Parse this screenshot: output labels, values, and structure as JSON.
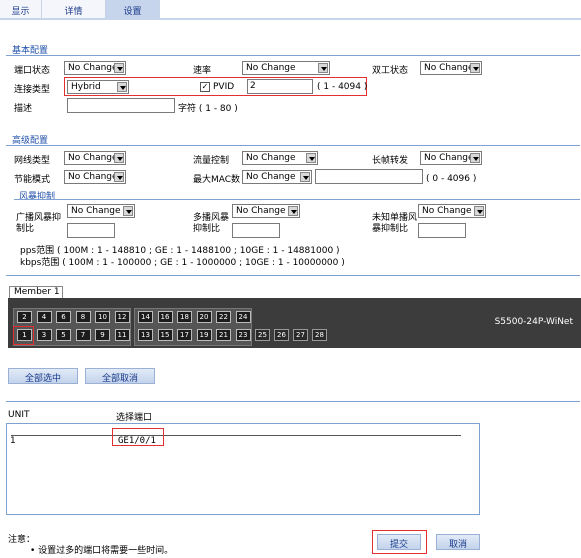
{
  "tabs": [
    "显示",
    "详情",
    "设置"
  ],
  "basic": {
    "title": "基本配置",
    "port_state_label": "端口状态",
    "port_state_value": "No Change",
    "speed_label": "速率",
    "speed_value": "No Change",
    "duplex_label": "双工状态",
    "duplex_value": "No Change",
    "link_type_label": "连接类型",
    "link_type_value": "Hybrid",
    "pvid_label": "PVID",
    "pvid_value": "2",
    "pvid_range": "( 1 - 4094 )",
    "desc_label": "描述",
    "desc_value": "",
    "desc_hint": "字符 ( 1 - 80 )"
  },
  "advanced": {
    "title": "高级配置",
    "mdi_label": "网线类型",
    "mdi_value": "No Change",
    "flow_label": "流量控制",
    "flow_value": "No Change",
    "jumbo_label": "长帧转发",
    "jumbo_value": "No Change",
    "power_label": "节能模式",
    "power_value": "No Change",
    "mac_label": "最大MAC数",
    "mac_value": "No Change",
    "mac_input": "",
    "mac_range": "( 0 - 4096 )"
  },
  "storm": {
    "title": "风暴抑制",
    "broadcast_label_1": "广播风暴抑",
    "broadcast_label_2": "制比",
    "broadcast_value": "No Change",
    "broadcast_input": "",
    "multicast_label_1": "多播风暴",
    "multicast_label_2": "抑制比",
    "multicast_value": "No Change",
    "multicast_input": "",
    "unicast_label_1": "未知单播风",
    "unicast_label_2": "暴抑制比",
    "unicast_value": "No Change",
    "unicast_input": "",
    "pps_range": "pps范围 ( 100M : 1 - 148810 ; GE : 1 - 1488100 ; 10GE : 1 - 14881000 )",
    "kbps_range": "kbps范围 ( 100M : 1 - 100000 ; GE : 1 - 1000000 ; 10GE : 1 - 10000000 )"
  },
  "device": {
    "member_tab": "Member 1",
    "model": "S5500-24P-WiNet",
    "top_ports": [
      "2",
      "4",
      "6",
      "8",
      "10",
      "12",
      "14",
      "16",
      "18",
      "20",
      "22",
      "24"
    ],
    "bottom_ports": [
      "1",
      "3",
      "5",
      "7",
      "9",
      "11",
      "13",
      "15",
      "17",
      "19",
      "21",
      "23"
    ],
    "sfp_ports": [
      "25",
      "26",
      "27",
      "28"
    ],
    "selected_port": "1"
  },
  "actions": {
    "select_all": "全部选中",
    "deselect_all": "全部取消"
  },
  "selection": {
    "unit_header": "UNIT",
    "ports_header": "选择端口",
    "unit": "1",
    "ports": "GE1/0/1"
  },
  "notes": {
    "label": "注意：",
    "item": "设置过多的端口将需要一些时间。"
  },
  "footer": {
    "submit": "提交",
    "cancel": "取消"
  },
  "colors": {
    "accent_red": "#e03030",
    "section_blue": "#1f4fa8"
  }
}
